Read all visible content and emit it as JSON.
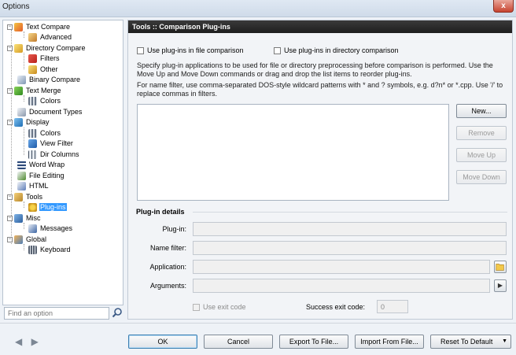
{
  "window": {
    "title": "Options",
    "close": "x"
  },
  "tree": {
    "items": [
      {
        "label": "Text Compare"
      },
      {
        "label": "Advanced"
      },
      {
        "label": "Directory Compare"
      },
      {
        "label": "Filters"
      },
      {
        "label": "Other"
      },
      {
        "label": "Binary Compare"
      },
      {
        "label": "Text Merge"
      },
      {
        "label": "Colors"
      },
      {
        "label": "Document Types"
      },
      {
        "label": "Display"
      },
      {
        "label": "Colors"
      },
      {
        "label": "View Filter"
      },
      {
        "label": "Dir Columns"
      },
      {
        "label": "Word Wrap"
      },
      {
        "label": "File Editing"
      },
      {
        "label": "HTML"
      },
      {
        "label": "Tools"
      },
      {
        "label": "Plug-ins"
      },
      {
        "label": "Misc"
      },
      {
        "label": "Messages"
      },
      {
        "label": "Global"
      },
      {
        "label": "Keyboard"
      }
    ],
    "expanders": {
      "collapse": "−"
    },
    "selected_index": 17
  },
  "find": {
    "placeholder": "Find an option"
  },
  "panel": {
    "header": "Tools :: Comparison Plug-ins",
    "cb_file": "Use plug-ins in file comparison",
    "cb_dir": "Use plug-ins in directory comparison",
    "para1": "Specify plug-in applications to be used for file or directory preprocessing before comparison is performed. Use the Move Up and Move Down commands or drag and drop the list items to reorder plug-ins.",
    "para2": "For name filter, use comma-separated DOS-style wildcard patterns with * and ? symbols, e.g. d?n* or *.cpp. Use '/' to replace commas in filters.",
    "buttons": {
      "new": "New...",
      "remove": "Remove",
      "move_up": "Move Up",
      "move_down": "Move Down"
    },
    "details": {
      "title": "Plug-in details",
      "plugin_label": "Plug-in:",
      "name_filter_label": "Name filter:",
      "application_label": "Application:",
      "arguments_label": "Arguments:",
      "use_exit_code": "Use exit code",
      "success_exit_code_label": "Success exit code:",
      "success_exit_code_value": "0",
      "arguments_arrow": "▶"
    }
  },
  "footer": {
    "nav": "◀ ▶",
    "ok": "OK",
    "cancel": "Cancel",
    "export": "Export To File...",
    "import": "Import From File...",
    "reset": "Reset To Default",
    "reset_arrow": "▼"
  }
}
